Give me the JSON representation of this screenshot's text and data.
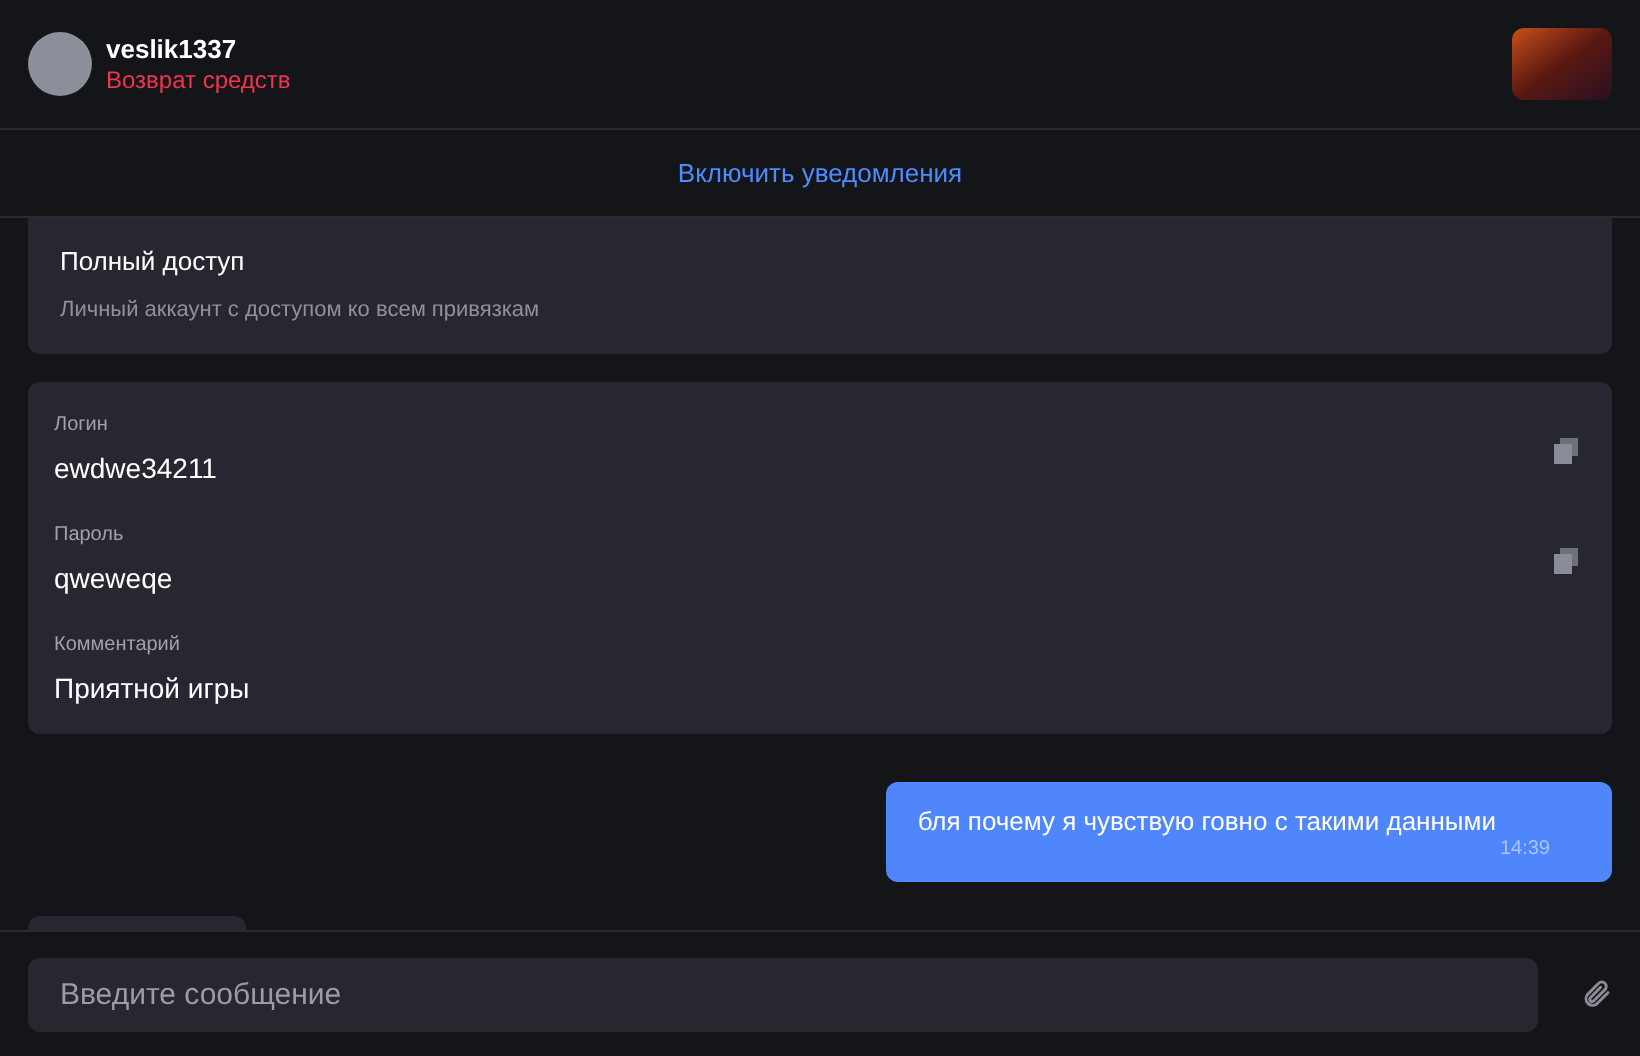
{
  "header": {
    "username": "veslik1337",
    "subtitle": "Возврат средств"
  },
  "notification_bar": {
    "link": "Включить уведомления"
  },
  "messages": [
    {
      "kind": "access",
      "title": "Полный доступ",
      "description": "Личный аккаунт с доступом ко всем привязкам"
    },
    {
      "kind": "credentials",
      "fields": [
        {
          "label": "Логин",
          "value": "ewdwe34211",
          "copyable": true
        },
        {
          "label": "Пароль",
          "value": "qweweqe",
          "copyable": true
        },
        {
          "label": "Комментарий",
          "value": "Приятной игры",
          "copyable": false
        }
      ]
    },
    {
      "kind": "outgoing",
      "text": "бля почему я чувствую говно с такими данными",
      "time": "14:39"
    },
    {
      "kind": "partial"
    }
  ],
  "composer": {
    "placeholder": "Введите сообщение"
  }
}
